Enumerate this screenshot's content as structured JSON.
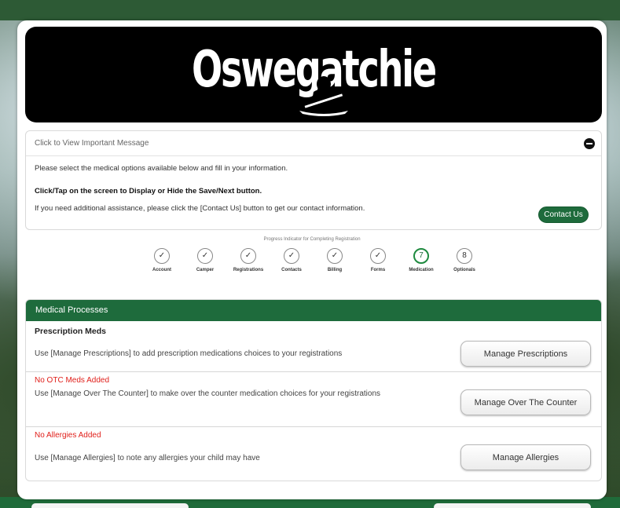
{
  "banner": {
    "logo_text": "Oswegatchie"
  },
  "message": {
    "header": "Click to View Important Message",
    "line1": "Please select the medical options available below and fill in your information.",
    "line2": "Click/Tap on the screen to Display or Hide the Save/Next button.",
    "line3": "If you need additional assistance, please click the [Contact Us] button to get our contact information.",
    "contact_button": "Contact Us"
  },
  "progress": {
    "label": "Progress Indicator for Completing Registration",
    "steps": [
      {
        "label": "Account",
        "symbol": "✓",
        "state": "done"
      },
      {
        "label": "Camper",
        "symbol": "✓",
        "state": "done"
      },
      {
        "label": "Registrations",
        "symbol": "✓",
        "state": "done"
      },
      {
        "label": "Contacts",
        "symbol": "✓",
        "state": "done"
      },
      {
        "label": "Billing",
        "symbol": "✓",
        "state": "done"
      },
      {
        "label": "Forms",
        "symbol": "✓",
        "state": "done"
      },
      {
        "label": "Medication",
        "symbol": "7",
        "state": "current"
      },
      {
        "label": "Optionals",
        "symbol": "8",
        "state": "pending"
      }
    ]
  },
  "panel": {
    "header": "Medical Processes",
    "sections": [
      {
        "title": "Prescription Meds",
        "status": "",
        "description": "Use [Manage Prescriptions] to add prescription medications choices to your registrations",
        "button": "Manage Prescriptions"
      },
      {
        "title": "",
        "status": "No OTC Meds Added",
        "description": "Use [Manage Over The Counter] to make over the counter medication choices for your registrations",
        "button": "Manage Over The Counter"
      },
      {
        "title": "",
        "status": "No Allergies Added",
        "description": "Use [Manage Allergies] to note any allergies your child may have",
        "button": "Manage Allergies"
      }
    ]
  },
  "colors": {
    "accent_green": "#1e6b3c",
    "alert_red": "#e0201b"
  }
}
